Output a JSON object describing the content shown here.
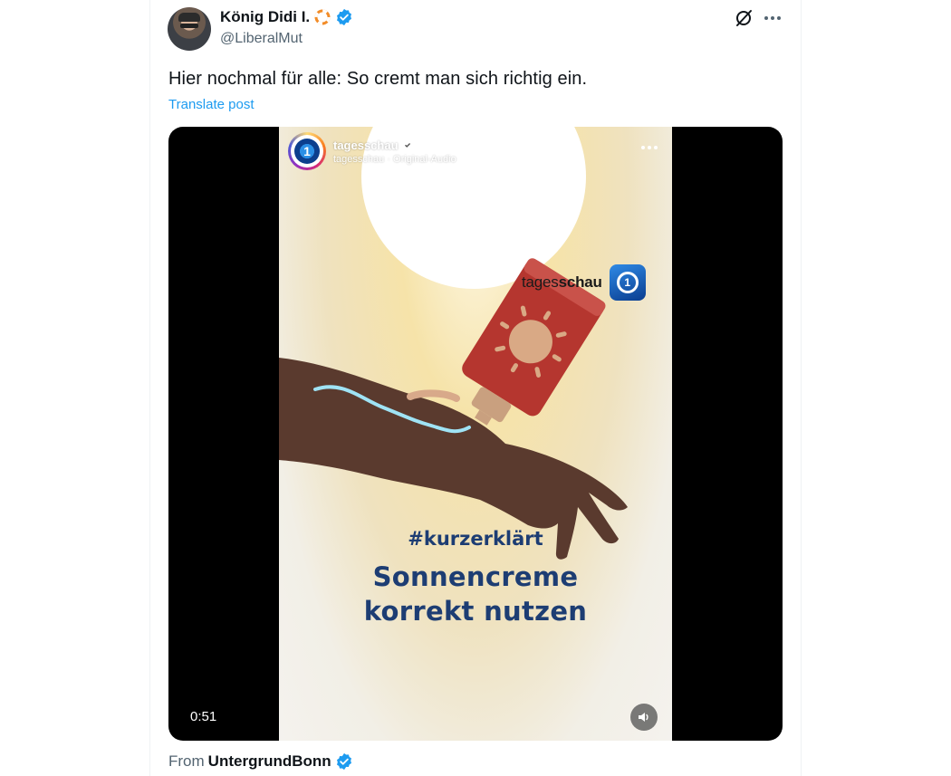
{
  "author": {
    "display_name": "König Didi I.",
    "handle": "@LiberalMut",
    "decoration_icon": "life-ring-icon",
    "verified_icon": "verified-badge-icon",
    "verified_color": "#1d9bf0"
  },
  "header_actions": {
    "grok_icon": "grok-icon",
    "more_icon": "more-horizontal-icon"
  },
  "post": {
    "text": "Hier nochmal für alle: So cremt man sich richtig ein.",
    "translate_label": "Translate post",
    "link_color": "#1d9bf0"
  },
  "video": {
    "account_name": "tagesschau",
    "account_subtitle": "tagesschau · Original-Audio",
    "brand_prefix": "tages",
    "brand_suffix": "schau",
    "hashtag": "#kurzerklärt",
    "title_line1": "Sonnencreme",
    "title_line2": "korrekt nutzen",
    "duration": "0:51",
    "mute_icon": "speaker-icon",
    "title_color": "#1d3d73"
  },
  "source": {
    "label": "From",
    "name": "UntergrundBonn",
    "verified_icon": "verified-badge-icon"
  }
}
